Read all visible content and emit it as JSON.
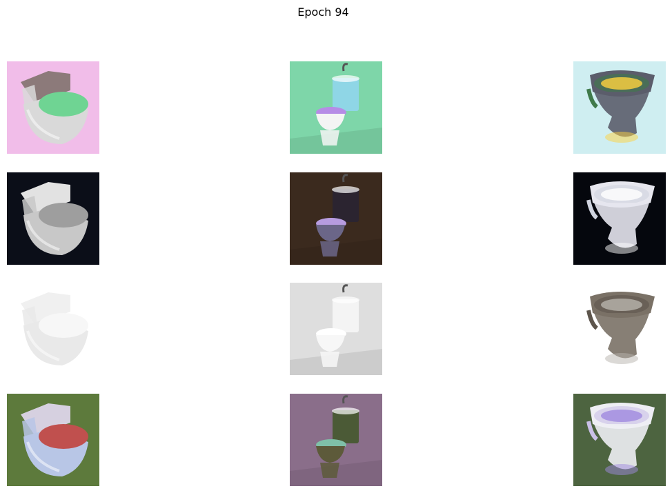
{
  "figure": {
    "title": "Epoch 94"
  },
  "grid": {
    "rows": 4,
    "columns": 3,
    "tiles": [
      {
        "row": 0,
        "col": 0,
        "subject": "toilet-one-piece",
        "palette": {
          "bg": "#f1bde9",
          "body": "#d9d9d9",
          "accent": "#6fd493",
          "tank": "#8c7a7a"
        }
      },
      {
        "row": 0,
        "col": 1,
        "subject": "toilet-with-sink-tank",
        "palette": {
          "bg": "#7ed6a9",
          "body": "#f4f4f4",
          "accent": "#b68ce6",
          "tank": "#8fd6e6"
        }
      },
      {
        "row": 0,
        "col": 2,
        "subject": "toilet-bowl-top-view",
        "palette": {
          "bg": "#cfeef1",
          "body": "#5b5d6b",
          "accent": "#ffd23e",
          "tank": "#3f7a4a"
        }
      },
      {
        "row": 1,
        "col": 0,
        "subject": "toilet-one-piece",
        "palette": {
          "bg": "#0b0e18",
          "body": "#c8c8c8",
          "accent": "#9e9e9e",
          "tank": "#e2e2e2"
        }
      },
      {
        "row": 1,
        "col": 1,
        "subject": "toilet-with-sink-tank",
        "palette": {
          "bg": "#3b2a1e",
          "body": "#6b6688",
          "accent": "#b79ce0",
          "tank": "#2b2430"
        }
      },
      {
        "row": 1,
        "col": 2,
        "subject": "toilet-bowl-top-view",
        "palette": {
          "bg": "#05070d",
          "body": "#e6e6ee",
          "accent": "#ffffff",
          "tank": "#d0d4df"
        }
      },
      {
        "row": 2,
        "col": 0,
        "subject": "toilet-one-piece",
        "palette": {
          "bg": "#ffffff",
          "body": "#e9e9e9",
          "accent": "#f7f7f7",
          "tank": "#f0f0f0"
        }
      },
      {
        "row": 2,
        "col": 1,
        "subject": "toilet-with-sink-tank",
        "palette": {
          "bg": "#dedede",
          "body": "#f7f7f7",
          "accent": "#ffffff",
          "tank": "#f4f4f4"
        }
      },
      {
        "row": 2,
        "col": 2,
        "subject": "toilet-bowl-top-view",
        "palette": {
          "bg": "#ffffff",
          "body": "#7a7166",
          "accent": "#b8b4ad",
          "tank": "#5d554c"
        }
      },
      {
        "row": 3,
        "col": 0,
        "subject": "toilet-one-piece",
        "palette": {
          "bg": "#5d7a3c",
          "body": "#b8c6e6",
          "accent": "#c0504e",
          "tank": "#d6d0e0"
        }
      },
      {
        "row": 3,
        "col": 1,
        "subject": "toilet-with-sink-tank",
        "palette": {
          "bg": "#8a6e8a",
          "body": "#5d5a3a",
          "accent": "#7fc0a8",
          "tank": "#4b5a36"
        }
      },
      {
        "row": 3,
        "col": 2,
        "subject": "toilet-bowl-top-view",
        "palette": {
          "bg": "#4d6440",
          "body": "#eeeef4",
          "accent": "#a08ae0",
          "tank": "#c9c0e6"
        }
      }
    ]
  }
}
